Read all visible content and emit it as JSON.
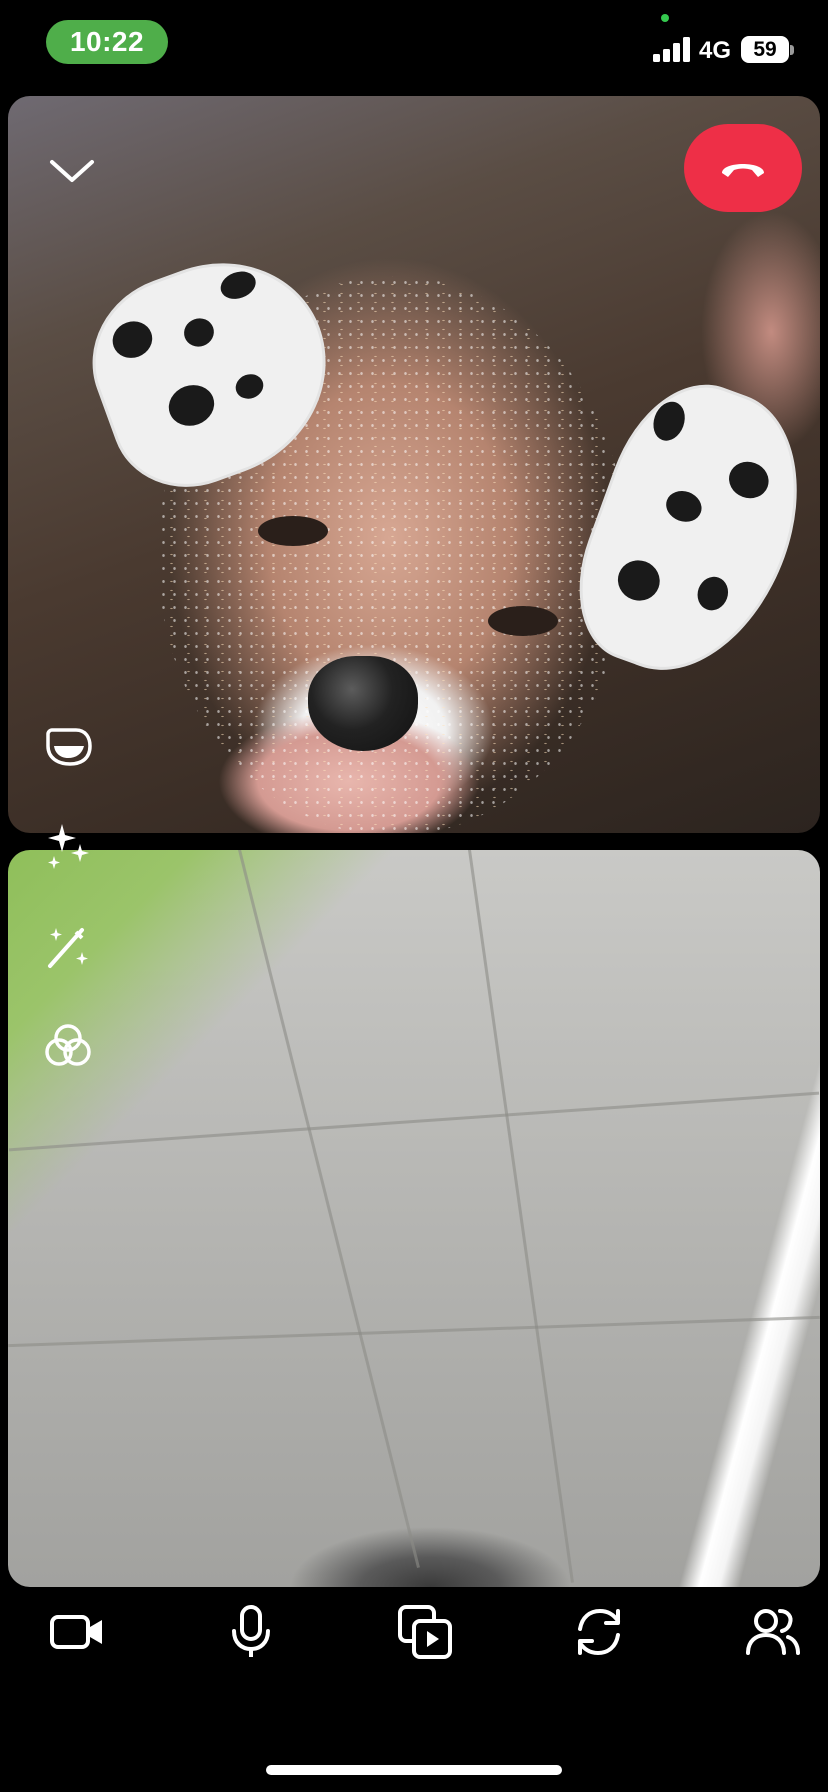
{
  "status_bar": {
    "time": "10:22",
    "network": "4G",
    "battery": "59",
    "accent_color": "#4fae4a"
  },
  "call": {
    "end_call_color": "#ee2f47",
    "icons": {
      "collapse": "chevron-down-icon",
      "end_call": "phone-hangup-icon",
      "lens": "lens-face-icon",
      "effects": "sparkles-icon",
      "magic": "magic-wand-icon",
      "filters": "color-filter-icon"
    }
  },
  "controls": [
    {
      "name": "video-camera-icon"
    },
    {
      "name": "microphone-icon"
    },
    {
      "name": "media-share-icon"
    },
    {
      "name": "flip-camera-icon"
    },
    {
      "name": "participants-icon"
    }
  ]
}
